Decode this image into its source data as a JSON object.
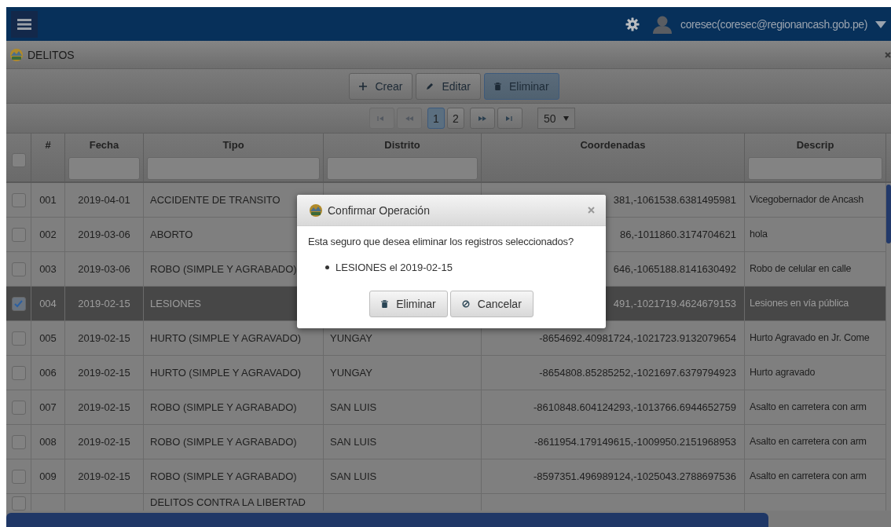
{
  "topbar": {
    "user": "coresec(coresec@regionancash.gob.pe)"
  },
  "panel": {
    "title": "DELITOS"
  },
  "toolbar": [
    {
      "label": "Crear",
      "kind": "plus",
      "selected": false
    },
    {
      "label": "Editar",
      "kind": "pencil",
      "selected": false
    },
    {
      "label": "Eliminar",
      "kind": "trash",
      "selected": true
    }
  ],
  "pager": {
    "nav_before": [
      {
        "kind": "first",
        "disabled": true
      },
      {
        "kind": "prev",
        "disabled": true
      }
    ],
    "pages": [
      {
        "label": "1",
        "selected": true
      },
      {
        "label": "2",
        "selected": false
      }
    ],
    "nav_after": [
      {
        "kind": "next",
        "disabled": false
      },
      {
        "kind": "last",
        "disabled": false
      }
    ],
    "page_size": "50"
  },
  "table": {
    "select_all": {
      "checked": false
    },
    "columns": [
      {
        "label": "#",
        "filter": false
      },
      {
        "label": "Fecha",
        "filter": true
      },
      {
        "label": "Tipo",
        "filter": true
      },
      {
        "label": "Distrito",
        "filter": true
      },
      {
        "label": "Coordenadas",
        "filter": false
      },
      {
        "label": "Descrip",
        "filter": true
      }
    ],
    "rows": [
      {
        "checked": false,
        "number": "001",
        "date": "2019-04-01",
        "type": "ACCIDENTE DE TRANSITO",
        "coords": "381,-1061538.6381495981",
        "description": "Vicegobernador de Ancash"
      },
      {
        "checked": false,
        "number": "002",
        "date": "2019-03-06",
        "type": "ABORTO",
        "coords": "86,-1011860.3174704621",
        "description": "hola"
      },
      {
        "checked": false,
        "number": "003",
        "date": "2019-03-06",
        "type": "ROBO (SIMPLE Y AGRABADO)",
        "coords": "646,-1065188.8141630492",
        "description": "Robo de celular en calle"
      },
      {
        "checked": true,
        "number": "004",
        "date": "2019-02-15",
        "type": "LESIONES",
        "coords": "491,-1021719.4624679153",
        "description": "Lesiones en vía pública"
      },
      {
        "checked": false,
        "number": "005",
        "date": "2019-02-15",
        "type": "HURTO (SIMPLE Y AGRAVADO)",
        "district": "YUNGAY",
        "coords": "-8654692.40981724,-1021723.9132079654",
        "description": "Hurto Agravado en Jr. Come"
      },
      {
        "checked": false,
        "number": "006",
        "date": "2019-02-15",
        "type": "HURTO (SIMPLE Y AGRAVADO)",
        "district": "YUNGAY",
        "coords": "-8654808.85285252,-1021697.6379794923",
        "description": "Hurto agravado"
      },
      {
        "checked": false,
        "number": "007",
        "date": "2019-02-15",
        "type": "ROBO (SIMPLE Y AGRABADO)",
        "district": "SAN LUIS",
        "coords": "-8610848.604124293,-1013766.6944652759",
        "description": "Asalto en carretera con arm"
      },
      {
        "checked": false,
        "number": "008",
        "date": "2019-02-15",
        "type": "ROBO (SIMPLE Y AGRABADO)",
        "district": "SAN LUIS",
        "coords": "-8611954.179149615,-1009950.2151968953",
        "description": "Asalto en carretera con arm"
      },
      {
        "checked": false,
        "number": "009",
        "date": "2019-02-15",
        "type": "ROBO (SIMPLE Y AGRABADO)",
        "district": "SAN LUIS",
        "coords": "-8597351.496989124,-1025043.2788697536",
        "description": "Asalto en carretera con arm"
      },
      {
        "checked": false,
        "type": "DELITOS CONTRA LA LIBERTAD"
      }
    ]
  },
  "dialog": {
    "title": "Confirmar Operación",
    "message": "Esta seguro que desea eliminar los registros seleccionados?",
    "items": [
      "LESIONES el 2019-02-15"
    ],
    "buttons": [
      {
        "label": "Eliminar",
        "kind": "trash"
      },
      {
        "label": "Cancelar",
        "kind": "cancel"
      }
    ]
  }
}
